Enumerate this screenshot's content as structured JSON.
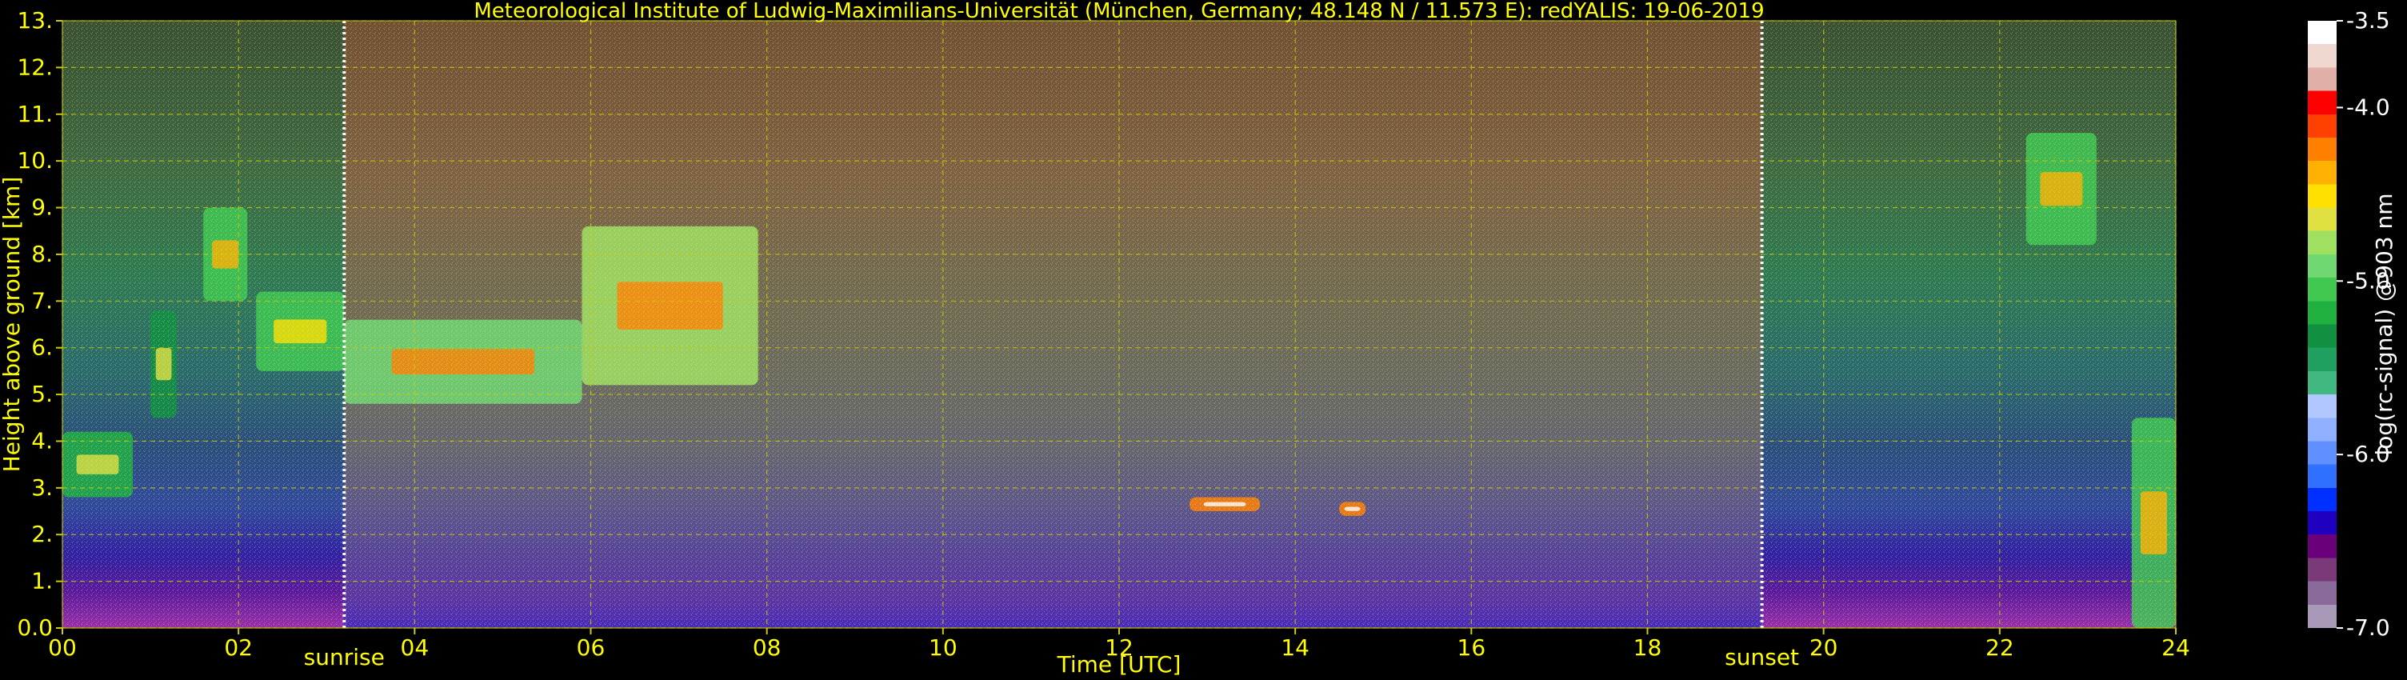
{
  "chart_data": {
    "type": "heatmap",
    "title": "Meteorological Institute of Ludwig-Maximilians-Universität (München, Germany; 48.148 N / 11.573 E):    redYALIS: 19-06-2019",
    "xlabel": "Time [UTC]",
    "ylabel": "Height above ground [km]",
    "xlim": [
      0,
      24
    ],
    "ylim": [
      0,
      13
    ],
    "x_ticks": [
      "00",
      "02",
      "04",
      "06",
      "08",
      "10",
      "12",
      "14",
      "16",
      "18",
      "20",
      "22",
      "24"
    ],
    "y_ticks": [
      "0.0",
      "1.",
      "2.",
      "3.",
      "4.",
      "5.",
      "6.",
      "7.",
      "8.",
      "9.",
      "10.",
      "11.",
      "12.",
      "13."
    ],
    "grid": true,
    "annotations": [
      {
        "label": "sunrise",
        "time": 3.2
      },
      {
        "label": "sunset",
        "time": 19.3
      }
    ],
    "colorbar": {
      "label": "log(rc-signal) @903 nm",
      "range": [
        -7.0,
        -3.5
      ],
      "ticks": [
        "-3.5",
        "-4.0",
        "-5.0",
        "-6.0",
        "-7.0"
      ],
      "tick_values": [
        -3.5,
        -4.0,
        -5.0,
        -6.0,
        -7.0
      ],
      "colors": [
        "#a899b8",
        "#8a6a9a",
        "#7a3a7a",
        "#6a007a",
        "#2000c0",
        "#0030ff",
        "#3070ff",
        "#6090ff",
        "#90b0ff",
        "#b0c8ff",
        "#40b880",
        "#20a060",
        "#109040",
        "#20b040",
        "#40c850",
        "#70d870",
        "#a0e060",
        "#e0e040",
        "#ffe000",
        "#ffb000",
        "#ff8000",
        "#ff4000",
        "#ff0000",
        "#e0b0a8",
        "#f0d8d0",
        "#ffffff"
      ]
    },
    "features": [
      {
        "name": "cloud layer",
        "t": [
          0.0,
          0.8
        ],
        "z": [
          2.8,
          4.2
        ],
        "level": -5.2
      },
      {
        "name": "cloud layer",
        "t": [
          1.0,
          1.3
        ],
        "z": [
          4.5,
          6.8
        ],
        "level": -5.3
      },
      {
        "name": "cloud layer",
        "t": [
          1.6,
          2.1
        ],
        "z": [
          7.0,
          9.0
        ],
        "level": -5.0
      },
      {
        "name": "cloud layer",
        "t": [
          2.2,
          3.2
        ],
        "z": [
          5.5,
          7.2
        ],
        "level": -5.1
      },
      {
        "name": "cloud layer",
        "t": [
          3.2,
          5.9
        ],
        "z": [
          4.8,
          6.6
        ],
        "level": -4.9
      },
      {
        "name": "cloud layer",
        "t": [
          5.9,
          7.9
        ],
        "z": [
          5.2,
          8.6
        ],
        "level": -4.8
      },
      {
        "name": "cloud layer",
        "t": [
          22.3,
          23.1
        ],
        "z": [
          8.2,
          10.6
        ],
        "level": -5.0
      },
      {
        "name": "cloud layer",
        "t": [
          12.8,
          13.6
        ],
        "z": [
          2.5,
          2.8
        ],
        "level": -4.2
      },
      {
        "name": "cloud layer",
        "t": [
          14.5,
          14.8
        ],
        "z": [
          2.4,
          2.7
        ],
        "level": -4.2
      },
      {
        "name": "boundary layer",
        "t": [
          23.5,
          24.0
        ],
        "z": [
          0.0,
          4.5
        ],
        "level": -5.0
      }
    ]
  }
}
